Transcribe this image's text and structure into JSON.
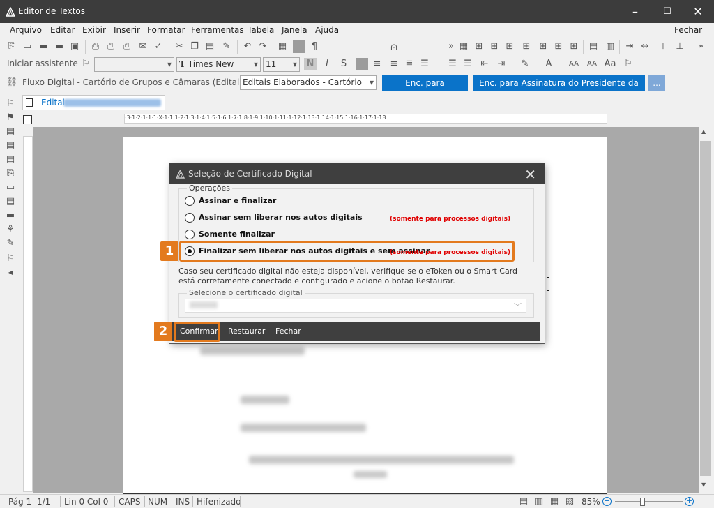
{
  "window": {
    "title": "Editor de Textos",
    "controls": [
      "–",
      "☐",
      "✕"
    ]
  },
  "menu": {
    "items": [
      "Arquivo",
      "Editar",
      "Exibir",
      "Inserir",
      "Formatar",
      "Ferramentas",
      "Tabela",
      "Janela",
      "Ajuda"
    ],
    "close_label": "Fechar"
  },
  "toolbar2": {
    "assistant_label": "Iniciar assistente",
    "font_name": "Times New Roman",
    "font_size": "11",
    "bold": "N",
    "italic": "I",
    "underline": "S"
  },
  "workflow": {
    "label": "Fluxo Digital - Cartório de Grupos e Câmaras (Edital) - Fila:",
    "queue": "Editais Elaborados - Cartório",
    "btn_sign": "Enc. para Assinatura",
    "btn_sign_president": "Enc. para Assinatura do Presidente da Seção",
    "btn_more": "..."
  },
  "tab": {
    "name": "Edital"
  },
  "ruler": "·3·1·2·1·1·1·X·1·1·1·2·1·3·1·4·1·5·1·6·1·7·1·8·1·9·1·10·1·11·1·12·1·13·1·14·1·15·1·16·1·17·1·18",
  "dialog": {
    "title": "Seleção de Certificado Digital",
    "group_operations": "Operações",
    "options": [
      {
        "label": "Assinar e finalizar",
        "checked": false,
        "note": ""
      },
      {
        "label": "Assinar sem liberar nos autos digitais",
        "checked": false,
        "note": "(somente para processos digitais)"
      },
      {
        "label": "Somente finalizar",
        "checked": false,
        "note": ""
      },
      {
        "label": "Finalizar sem liberar nos autos digitais e sem assinar",
        "checked": true,
        "note": "(somente para processos digitais)"
      }
    ],
    "info": "Caso seu certificado digital não esteja disponível, verifique se o eToken ou o Smart Card está corretamente conectado e configurado e acione o botão Restaurar.",
    "group_cert": "Selecione o certificado digital",
    "buttons": {
      "confirm": "Confirmar",
      "restore": "Restaurar",
      "close": "Fechar"
    }
  },
  "callouts": [
    "1",
    "2"
  ],
  "status": {
    "page": "Pág 1",
    "pages": "1/1",
    "position": "Lin 0  Col 0",
    "caps": "CAPS",
    "num": "NUM",
    "ins": "INS",
    "hyphen": "Hifenizado",
    "zoom": "85%"
  },
  "colors": {
    "accent_blue": "#0a73c9",
    "callout_orange": "#e37a1e",
    "note_red": "#e00000",
    "titlebar": "#3c3c3c"
  }
}
